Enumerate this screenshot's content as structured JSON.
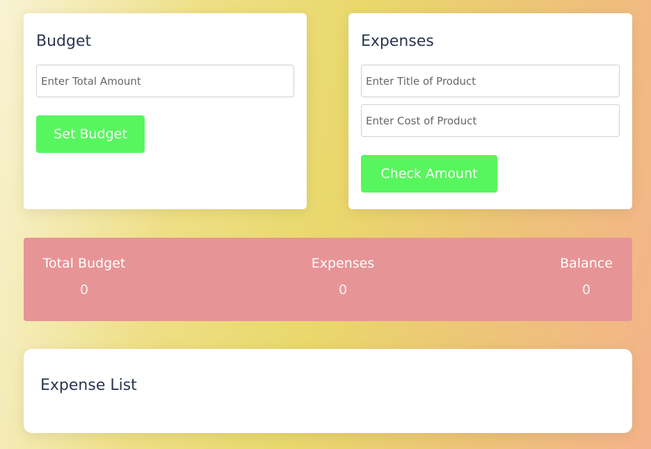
{
  "budget": {
    "title": "Budget",
    "amount_placeholder": "Enter Total Amount",
    "amount_value": "",
    "set_button": "Set Budget"
  },
  "expenses": {
    "title": "Expenses",
    "title_placeholder": "Enter Title of Product",
    "title_value": "",
    "cost_placeholder": "Enter Cost of Product",
    "cost_value": "",
    "check_button": "Check Amount"
  },
  "summary": {
    "total_budget_label": "Total Budget",
    "total_budget_value": "0",
    "expenses_label": "Expenses",
    "expenses_value": "0",
    "balance_label": "Balance",
    "balance_value": "0"
  },
  "expense_list": {
    "title": "Expense List",
    "items": []
  },
  "colors": {
    "button": "#57f65e",
    "summary_panel": "#e79496",
    "heading_text": "#2c3550"
  }
}
